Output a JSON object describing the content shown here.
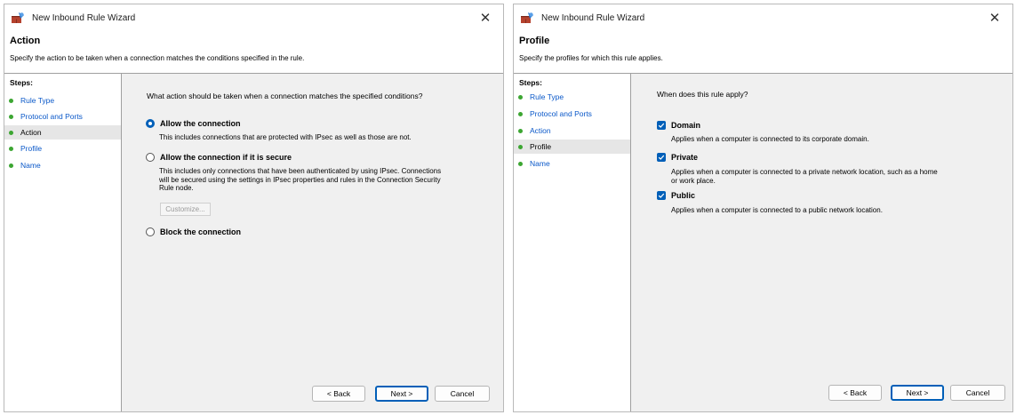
{
  "left_window": {
    "title": "New Inbound Rule Wizard",
    "close_glyph": "✕",
    "header": {
      "title": "Action",
      "subtitle": "Specify the action to be taken when a connection matches the conditions specified in the rule."
    },
    "steps_label": "Steps:",
    "steps": [
      {
        "label": "Rule Type"
      },
      {
        "label": "Protocol and Ports"
      },
      {
        "label": "Action"
      },
      {
        "label": "Profile"
      },
      {
        "label": "Name"
      }
    ],
    "current_step": "Action",
    "question": "What action should be taken when a connection matches the specified conditions?",
    "options": [
      {
        "title": "Allow the connection",
        "selected": true,
        "description": "This includes connections that are protected with IPsec as well as those are not."
      },
      {
        "title": "Allow the connection if it is secure",
        "selected": false,
        "description_lines": [
          "This includes only connections that have been authenticated by using IPsec.  Connections",
          "will be secured using the settings in IPsec properties and rules in the Connection Security",
          "Rule node."
        ]
      },
      {
        "title": "Block the connection",
        "selected": false
      }
    ],
    "customize_label": "Customize...",
    "buttons": {
      "back": "< Back",
      "next": "Next >",
      "cancel": "Cancel"
    }
  },
  "right_window": {
    "title": "New Inbound Rule Wizard",
    "close_glyph": "✕",
    "header": {
      "title": "Profile",
      "subtitle": "Specify the profiles for which this rule applies."
    },
    "steps_label": "Steps:",
    "steps": [
      {
        "label": "Rule Type"
      },
      {
        "label": "Protocol and Ports"
      },
      {
        "label": "Action"
      },
      {
        "label": "Profile"
      },
      {
        "label": "Name"
      }
    ],
    "current_step": "Profile",
    "question": "When does this rule apply?",
    "profiles": [
      {
        "title": "Domain",
        "checked": true,
        "description_lines": [
          "Applies when a computer is connected to its corporate domain."
        ]
      },
      {
        "title": "Private",
        "checked": true,
        "description_lines": [
          "Applies when a computer is connected to a private network location, such as a home",
          "or work place."
        ]
      },
      {
        "title": "Public",
        "checked": true,
        "description_lines": [
          "Applies when a computer is connected to a public network location."
        ]
      }
    ],
    "buttons": {
      "back": "< Back",
      "next": "Next >",
      "cancel": "Cancel"
    }
  },
  "colors": {
    "accent": "#005fb8",
    "step_dot": "#3ca632",
    "link": "#0a58c9",
    "panel_bg": "#f0f0f0"
  },
  "icons": {
    "app_icon": "firewall-wizard-icon",
    "step_bullet": "green-dot-icon",
    "check": "checkmark-icon"
  }
}
